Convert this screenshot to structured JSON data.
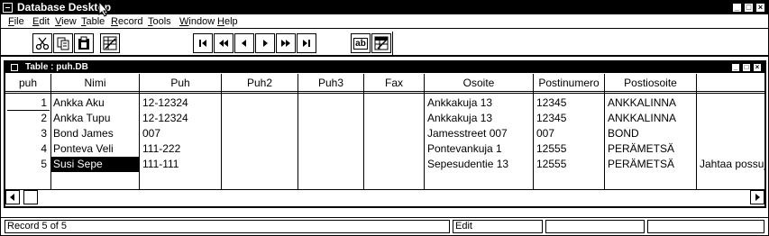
{
  "window": {
    "title": "Database Desktop"
  },
  "menu": [
    {
      "label": "File",
      "u": "F",
      "rest": "ile"
    },
    {
      "label": "Edit",
      "u": "E",
      "rest": "dit"
    },
    {
      "label": "View",
      "u": "V",
      "rest": "iew"
    },
    {
      "label": "Table",
      "u": "T",
      "rest": "able"
    },
    {
      "label": "Record",
      "u": "R",
      "rest": "ecord"
    },
    {
      "label": "Tools",
      "u": "T",
      "rest": "ools"
    },
    {
      "label": "Window",
      "u": "W",
      "rest": "indow"
    },
    {
      "label": "Help",
      "u": "H",
      "rest": "elp"
    }
  ],
  "toolbar": {
    "icons": [
      "scissors-icon",
      "copy-icon",
      "paste-icon",
      "restructure-icon",
      "first-record-icon",
      "prev-set-icon",
      "prev-record-icon",
      "next-record-icon",
      "next-set-icon",
      "last-record-icon",
      "field-view-icon",
      "edit-data-icon"
    ],
    "field_view_text": "ab"
  },
  "table_window": {
    "title": "Table : puh.DB"
  },
  "grid": {
    "columns": [
      "puh",
      "Nimi",
      "Puh",
      "Puh2",
      "Puh3",
      "Fax",
      "Osoite",
      "Postinumero",
      "Postiosoite",
      ""
    ],
    "rows": [
      {
        "puh": "1",
        "nimi": "Ankka Aku",
        "puh1": "12-12324",
        "puh2": "",
        "puh3": "",
        "fax": "",
        "osoite": "Ankkakuja 13",
        "postinumero": "12345",
        "postiosoite": "ANKKALINNA",
        "extra": ""
      },
      {
        "puh": "2",
        "nimi": "Ankka Tupu",
        "puh1": "12-12324",
        "puh2": "",
        "puh3": "",
        "fax": "",
        "osoite": "Ankkakuja 13",
        "postinumero": "12345",
        "postiosoite": "ANKKALINNA",
        "extra": ""
      },
      {
        "puh": "3",
        "nimi": "Bond James",
        "puh1": "007",
        "puh2": "",
        "puh3": "",
        "fax": "",
        "osoite": "Jamesstreet 007",
        "postinumero": "007",
        "postiosoite": "BOND",
        "extra": ""
      },
      {
        "puh": "4",
        "nimi": "Ponteva Veli",
        "puh1": "111-222",
        "puh2": "",
        "puh3": "",
        "fax": "",
        "osoite": "Pontevankuja 1",
        "postinumero": "12555",
        "postiosoite": "PERÄMETSÄ",
        "extra": ""
      },
      {
        "puh": "5",
        "nimi": "Susi Sepe",
        "puh1": "111-111",
        "puh2": "",
        "puh3": "",
        "fax": "",
        "osoite": "Sepesudentie 13",
        "postinumero": "12555",
        "postiosoite": "PERÄMETSÄ",
        "extra": "Jahtaa possuja"
      }
    ],
    "selected_row": 5,
    "selected_field": "nimi"
  },
  "status": {
    "record": "Record 5 of 5",
    "mode": "Edit",
    "cell3": "",
    "cell4": ""
  }
}
